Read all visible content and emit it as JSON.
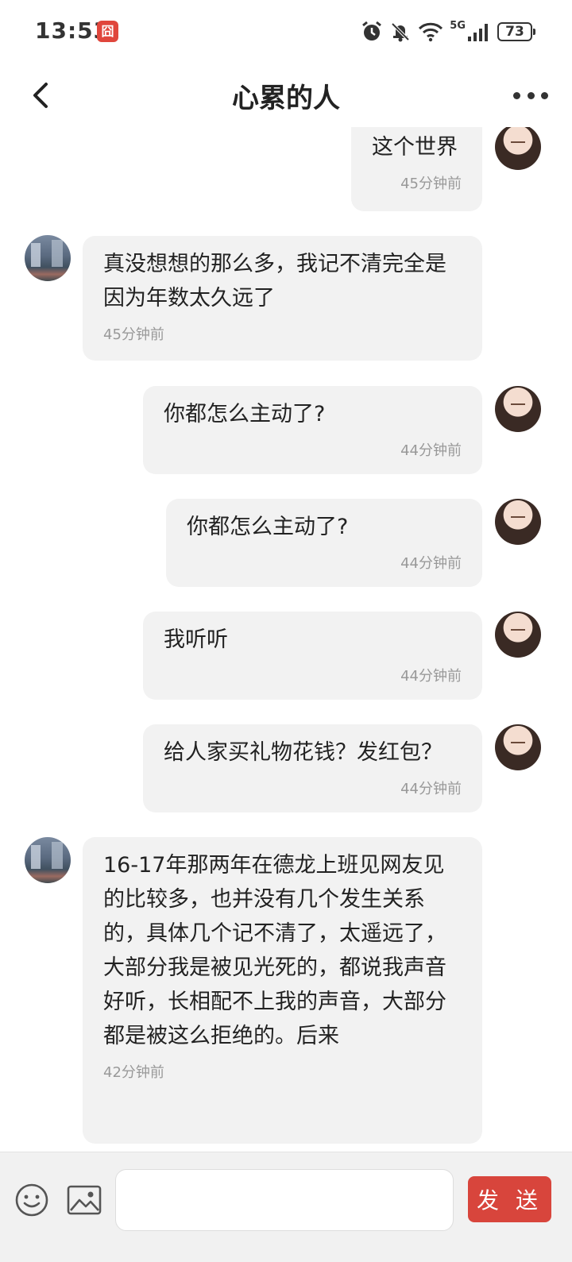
{
  "status_bar": {
    "time": "13:53",
    "app_badge": "囧",
    "network": "5G",
    "battery": "73"
  },
  "header": {
    "title": "心累的人"
  },
  "messages": [
    {
      "side": "right",
      "text": "这个世界",
      "time": "45分钟前"
    },
    {
      "side": "left",
      "text": "真没想想的那么多，我记不清完全是因为年数太久远了",
      "time": "45分钟前"
    },
    {
      "side": "right",
      "text": "你都怎么主动了?",
      "time": "44分钟前"
    },
    {
      "side": "right",
      "text": "你都怎么主动了?",
      "time": "44分钟前"
    },
    {
      "side": "right",
      "text": "我听听",
      "time": "44分钟前"
    },
    {
      "side": "right",
      "text": "给人家买礼物花钱？发红包？",
      "time": "44分钟前"
    },
    {
      "side": "left",
      "text": "16-17年那两年在德龙上班见网友见的比较多，也并没有几个发生关系的，具体几个记不清了，太遥远了，大部分我是被见光死的，都说我声音好听，长相配不上我的声音，大部分都是被这么拒绝的。后来",
      "time": "42分钟前"
    }
  ],
  "input_bar": {
    "message_value": "",
    "send_label": "发 送"
  },
  "colors": {
    "accent": "#d8453c",
    "bubble": "#f2f2f2",
    "background": "#ffffff"
  },
  "icons": [
    "back-arrow-icon",
    "more-dots-icon",
    "emoji-icon",
    "image-icon",
    "alarm-icon",
    "mute-bell-icon",
    "wifi-icon",
    "signal-icon",
    "battery-icon"
  ]
}
